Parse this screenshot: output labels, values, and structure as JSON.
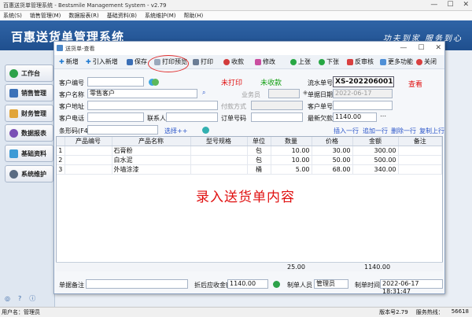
{
  "app": {
    "title": "百惠送货单管理系统 - Bestsmile Management System - v2.79",
    "menu": [
      "系统(S)",
      "销售管理(M)",
      "数据报表(R)",
      "基础资料(B)",
      "系统维护(M)",
      "帮助(H)"
    ],
    "banner_title": "百惠送货单管理系统",
    "slogan": "功夫到家 服务到心",
    "nav": [
      "工作台",
      "销售管理",
      "财务管理",
      "数据报表",
      "基础资料",
      "系统维护"
    ],
    "status": {
      "user": "用户名：管理员",
      "version": "版本号2.79",
      "service": "服务热线：",
      "code": "56618"
    }
  },
  "dialog": {
    "title": "送货单-查看",
    "toolbar": [
      "新增",
      "引入新增",
      "保存",
      "打印预览",
      "打印",
      "收款",
      "修改",
      "上张",
      "下张",
      "反审核",
      "更多功能",
      "关闭"
    ],
    "status_print": "未打印",
    "status_pay": "未收款",
    "view_label": "查看",
    "labels": {
      "customer_code": "客户编号",
      "customer_name": "客户名称",
      "customer_addr": "客户地址",
      "customer_phone": "客户电话",
      "contact": "联系人",
      "salesman": "业务员",
      "pay_method": "付款方式",
      "order_no": "订单号码",
      "serial_no": "流水单号",
      "doc_date": "单据日期",
      "customer_doc": "客户单号",
      "latest_debt": "最新欠款",
      "barcode": "条形码(F4)",
      "select": "选择++",
      "insert_row": "插入一行",
      "add_row": "追加一行",
      "delete_row": "删除一行",
      "copy_row": "复制上行"
    },
    "values": {
      "customer_name": "零售客户",
      "serial_no": "XS-202206001",
      "doc_date": "2022-06-17",
      "latest_debt": "1140.00"
    },
    "columns": [
      "",
      "产品编号",
      "产品名称",
      "型号规格",
      "单位",
      "数量",
      "价格",
      "金额",
      "备注"
    ],
    "rows": [
      {
        "no": "1",
        "code": "",
        "name": "石膏粉",
        "spec": "",
        "unit": "包",
        "qty": "10.00",
        "price": "30.00",
        "amount": "300.00",
        "remark": ""
      },
      {
        "no": "2",
        "code": "",
        "name": "白水泥",
        "spec": "",
        "unit": "包",
        "qty": "10.00",
        "price": "50.00",
        "amount": "500.00",
        "remark": ""
      },
      {
        "no": "3",
        "code": "",
        "name": "外墙涂漆",
        "spec": "",
        "unit": "桶",
        "qty": "5.00",
        "price": "68.00",
        "amount": "340.00",
        "remark": ""
      }
    ],
    "totals": {
      "qty": "25.00",
      "amount": "1140.00"
    },
    "overlay_text": "录入送货单内容",
    "footer": {
      "remark_label": "单据备注",
      "discount_label": "折后应收金额",
      "discount_value": "1140.00",
      "maker_label": "制单人员",
      "maker_value": "管理员",
      "time_label": "制单时间",
      "time_value": "2022-06-17 18:31:47"
    }
  }
}
